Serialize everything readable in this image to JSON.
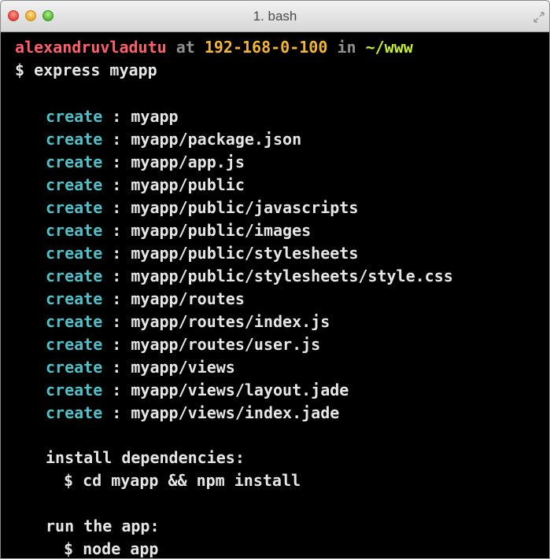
{
  "window": {
    "title": "1. bash"
  },
  "prompt": {
    "user": "alexandruvladutu",
    "at": "at",
    "host": "192-168-0-100",
    "in": "in",
    "dir": "~/www",
    "symbol": "$",
    "command": "express myapp"
  },
  "output": {
    "create_label": "create",
    "separator": ":",
    "created": [
      "myapp",
      "myapp/package.json",
      "myapp/app.js",
      "myapp/public",
      "myapp/public/javascripts",
      "myapp/public/images",
      "myapp/public/stylesheets",
      "myapp/public/stylesheets/style.css",
      "myapp/routes",
      "myapp/routes/index.js",
      "myapp/routes/user.js",
      "myapp/views",
      "myapp/views/layout.jade",
      "myapp/views/index.jade"
    ],
    "install_heading": "install dependencies:",
    "install_command": "$ cd myapp && npm install",
    "run_heading": "run the app:",
    "run_command": "$ node app"
  },
  "colors": {
    "user": "#ff5f6a",
    "host": "#f3b431",
    "dir": "#c8ef2e",
    "create": "#4fc0c8",
    "text": "#e6e6e6",
    "background": "#000000"
  }
}
